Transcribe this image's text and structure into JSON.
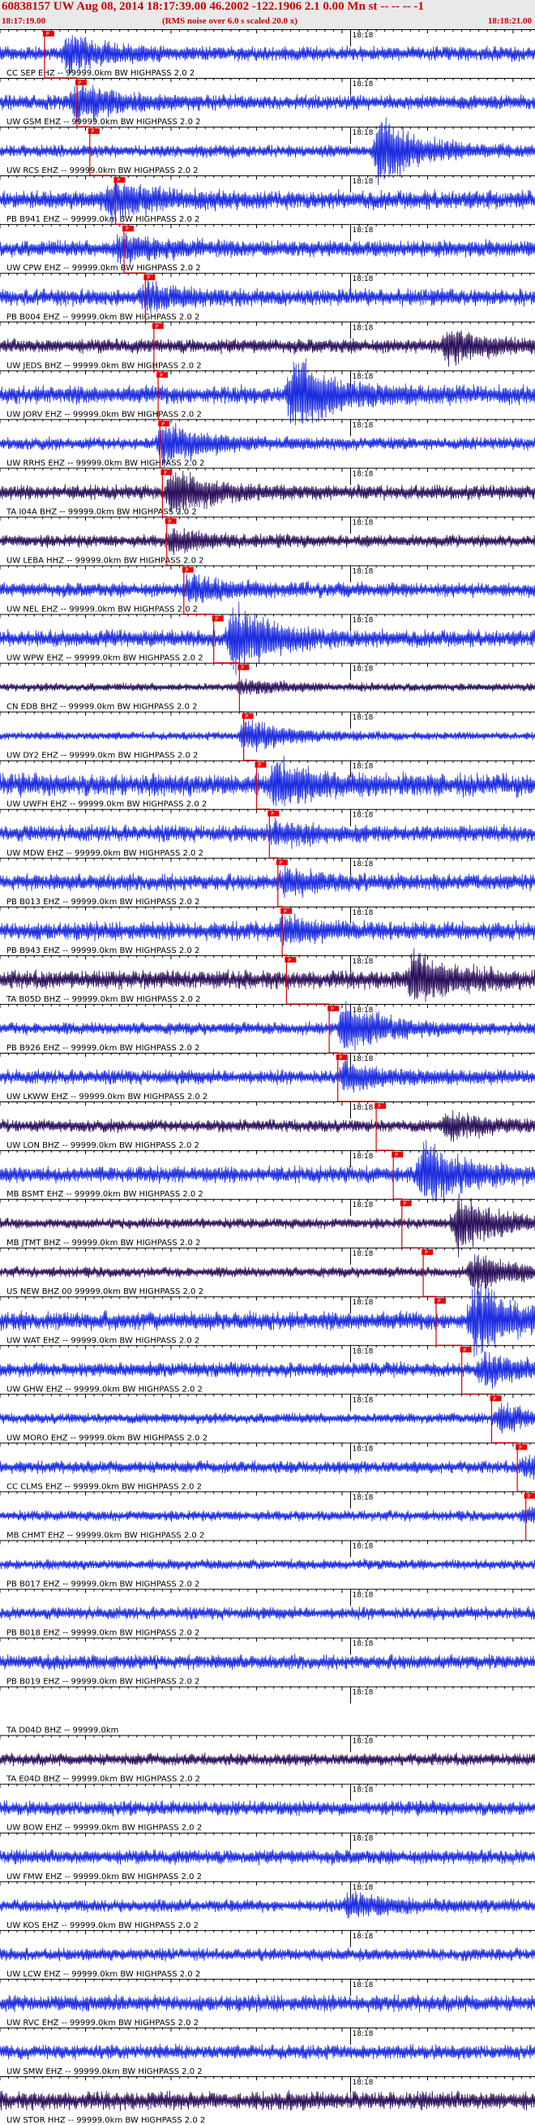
{
  "header": {
    "title": "60838157 UW Aug 08, 2014 18:17:39.00    46.2002 -122.1906  2.1 0.00 Mn st -- -- --  -1",
    "start_time": "18:17:19.00",
    "end_time": "18:18:21.00",
    "subtitle": "(RMS noise over 6.0 s scaled 20.0 x)"
  },
  "chart_data": {
    "type": "line",
    "description_free": true,
    "time_start_s": 0,
    "time_end_s": 62,
    "minute_tick_label": "18:18",
    "minute_tick_time_s": 41,
    "colors": {
      "trace": "#1a2be0",
      "trace_dark": "#2a0f5a",
      "pick": "#dd0000",
      "pick_label_bg": "#ee0000",
      "text": "#000000"
    },
    "pick_label": "P",
    "traces": [
      {
        "label": "CC SEP EHZ -- 99999.0km BW  HIGHPASS  2.0  2",
        "pick_s": 5.2,
        "amp": 0.35,
        "event_s": 8,
        "event_amp": 0.8,
        "dark": false
      },
      {
        "label": "UW GSM EHZ -- 99999.0km BW  HIGHPASS  2.0  2",
        "pick_s": 9.0,
        "amp": 0.35,
        "event_s": 9,
        "event_amp": 0.9,
        "dark": false
      },
      {
        "label": "UW RCS EHZ -- 99999.0km BW  HIGHPASS  2.0  2",
        "pick_s": 10.5,
        "amp": 0.3,
        "event_s": 44,
        "event_amp": 1.6,
        "dark": false
      },
      {
        "label": "PB B941 EHZ -- 99999.0km BW  HIGHPASS  2.0  2",
        "pick_s": 13.5,
        "amp": 0.45,
        "event_s": 13,
        "event_amp": 0.7,
        "dark": false
      },
      {
        "label": "UW CPW EHZ -- 99999.0km BW  HIGHPASS  2.0  2",
        "pick_s": 14.5,
        "amp": 0.4,
        "event_s": 14,
        "event_amp": 0.6,
        "dark": false
      },
      {
        "label": "PB B004 EHZ -- 99999.0km BW  HIGHPASS  2.0  2",
        "pick_s": 17.0,
        "amp": 0.4,
        "event_s": 17,
        "event_amp": 0.5,
        "dark": false
      },
      {
        "label": "UW JEDS BHZ -- 99999.0km BW  HIGHPASS  2.0  2",
        "pick_s": 18.0,
        "amp": 0.35,
        "event_s": 52,
        "event_amp": 0.8,
        "dark": true
      },
      {
        "label": "UW JORV EHZ -- 99999.0km BW  HIGHPASS  2.0  2",
        "pick_s": 18.5,
        "amp": 0.45,
        "event_s": 34,
        "event_amp": 1.8,
        "dark": false
      },
      {
        "label": "UW RRHS EHZ -- 99999.0km BW  HIGHPASS  2.0  2",
        "pick_s": 18.7,
        "amp": 0.3,
        "event_s": 19,
        "event_amp": 1.0,
        "dark": false
      },
      {
        "label": "TA I04A BHZ -- 99999.0km BW  HIGHPASS  2.0  2",
        "pick_s": 19.0,
        "amp": 0.35,
        "event_s": 20,
        "event_amp": 1.1,
        "dark": true
      },
      {
        "label": "UW LEBA HHZ -- 99999.0km BW  HIGHPASS  2.0  2",
        "pick_s": 19.5,
        "amp": 0.3,
        "event_s": 20,
        "event_amp": 0.5,
        "dark": true
      },
      {
        "label": "UW NEL EHZ -- 99999.0km BW  HIGHPASS  2.0  2",
        "pick_s": 21.5,
        "amp": 0.35,
        "event_s": 22,
        "event_amp": 0.6,
        "dark": false
      },
      {
        "label": "UW WPW EHZ -- 99999.0km BW  HIGHPASS  2.0  2",
        "pick_s": 25.0,
        "amp": 0.4,
        "event_s": 27,
        "event_amp": 1.6,
        "dark": false
      },
      {
        "label": "CN EDB BHZ -- 99999.0km BW  HIGHPASS  2.0  2",
        "pick_s": 28.0,
        "amp": 0.2,
        "event_s": 28,
        "event_amp": 0.3,
        "dark": true
      },
      {
        "label": "UW DY2 EHZ -- 99999.0km BW  HIGHPASS  2.0  2",
        "pick_s": 28.5,
        "amp": 0.2,
        "event_s": 28.5,
        "event_amp": 0.8,
        "dark": false
      },
      {
        "label": "UW UWFH EHZ -- 99999.0km BW  HIGHPASS  2.0  2",
        "pick_s": 30.0,
        "amp": 0.55,
        "event_s": 32,
        "event_amp": 0.9,
        "dark": false
      },
      {
        "label": "UW MDW EHZ -- 99999.0km BW  HIGHPASS  2.0  2",
        "pick_s": 31.5,
        "amp": 0.4,
        "event_s": 32,
        "event_amp": 0.5,
        "dark": false
      },
      {
        "label": "PB B013 EHZ -- 99999.0km BW  HIGHPASS  2.0  2",
        "pick_s": 32.5,
        "amp": 0.4,
        "event_s": 33,
        "event_amp": 0.5,
        "dark": false
      },
      {
        "label": "PB B943 EHZ -- 99999.0km BW  HIGHPASS  2.0  2",
        "pick_s": 33.0,
        "amp": 0.45,
        "event_s": 33,
        "event_amp": 0.5,
        "dark": false
      },
      {
        "label": "TA B05D BHZ -- 99999.0km BW  HIGHPASS  2.0  2",
        "pick_s": 33.5,
        "amp": 0.45,
        "event_s": 48,
        "event_amp": 1.2,
        "dark": true
      },
      {
        "label": "PB B926 EHZ -- 99999.0km BW  HIGHPASS  2.0  2",
        "pick_s": 38.5,
        "amp": 0.3,
        "event_s": 40,
        "event_amp": 1.2,
        "dark": false
      },
      {
        "label": "UW LKWW EHZ -- 99999.0km BW  HIGHPASS  2.0  2",
        "pick_s": 39.5,
        "amp": 0.35,
        "event_s": 40,
        "event_amp": 0.6,
        "dark": false
      },
      {
        "label": "UW LON BHZ -- 99999.0km BW  HIGHPASS  2.0  2",
        "pick_s": 44.0,
        "amp": 0.3,
        "event_s": 52,
        "event_amp": 0.6,
        "dark": true
      },
      {
        "label": "MB BSMT EHZ -- 99999.0km BW  HIGHPASS  2.0  2",
        "pick_s": 46.0,
        "amp": 0.4,
        "event_s": 49,
        "event_amp": 1.6,
        "dark": false
      },
      {
        "label": "MB JTMT BHZ -- 99999.0km BW  HIGHPASS  2.0  2",
        "pick_s": 47.0,
        "amp": 0.25,
        "event_s": 53,
        "event_amp": 1.4,
        "dark": true
      },
      {
        "label": "US NEW BHZ 00 99999.0km BW  HIGHPASS  2.0  2",
        "pick_s": 49.5,
        "amp": 0.25,
        "event_s": 55,
        "event_amp": 0.9,
        "dark": true
      },
      {
        "label": "UW WAT EHZ -- 99999.0km BW  HIGHPASS  2.0  2",
        "pick_s": 51.0,
        "amp": 0.45,
        "event_s": 55,
        "event_amp": 1.8,
        "dark": false
      },
      {
        "label": "UW GHW EHZ -- 99999.0km BW  HIGHPASS  2.0  2",
        "pick_s": 54.0,
        "amp": 0.35,
        "event_s": 56,
        "event_amp": 0.7,
        "dark": false
      },
      {
        "label": "UW MORO EHZ -- 99999.0km BW  HIGHPASS  2.0  2",
        "pick_s": 57.5,
        "amp": 0.25,
        "event_s": 58,
        "event_amp": 0.6,
        "dark": false
      },
      {
        "label": "CC CLMS EHZ -- 99999.0km BW  HIGHPASS  2.0  2",
        "pick_s": 60.5,
        "amp": 0.3,
        "event_s": 61,
        "event_amp": 0.4,
        "dark": false
      },
      {
        "label": "MB CHMT EHZ -- 99999.0km BW  HIGHPASS  2.0  2",
        "pick_s": 61.5,
        "amp": 0.25,
        "event_s": 61,
        "event_amp": 0.3,
        "dark": false
      },
      {
        "label": "PB B017 EHZ -- 99999.0km BW  HIGHPASS  2.0  2",
        "pick_s": null,
        "amp": 0.25,
        "event_s": null,
        "event_amp": 0,
        "dark": false
      },
      {
        "label": "PB B018 EHZ -- 99999.0km BW  HIGHPASS  2.0  2",
        "pick_s": null,
        "amp": 0.3,
        "event_s": null,
        "event_amp": 0,
        "dark": false
      },
      {
        "label": "PB B019 EHZ -- 99999.0km BW  HIGHPASS  2.0  2",
        "pick_s": null,
        "amp": 0.35,
        "event_s": null,
        "event_amp": 0,
        "dark": false
      },
      {
        "label": "TA D04D BHZ -- 99999.0km",
        "pick_s": null,
        "amp": 0.0,
        "event_s": null,
        "event_amp": 0,
        "dark": true
      },
      {
        "label": "TA E04D BHZ -- 99999.0km BW  HIGHPASS  2.0  2",
        "pick_s": null,
        "amp": 0.3,
        "event_s": null,
        "event_amp": 0,
        "dark": true
      },
      {
        "label": "UW BOW EHZ -- 99999.0km BW  HIGHPASS  2.0  2",
        "pick_s": null,
        "amp": 0.35,
        "event_s": null,
        "event_amp": 0,
        "dark": false
      },
      {
        "label": "UW FMW EHZ -- 99999.0km BW  HIGHPASS  2.0  2",
        "pick_s": null,
        "amp": 0.35,
        "event_s": null,
        "event_amp": 0,
        "dark": false
      },
      {
        "label": "UW KOS EHZ -- 99999.0km BW  HIGHPASS  2.0  2",
        "pick_s": null,
        "amp": 0.3,
        "event_s": 40.5,
        "event_amp": 0.6,
        "dark": false
      },
      {
        "label": "UW LCW EHZ -- 99999.0km BW  HIGHPASS  2.0  2",
        "pick_s": null,
        "amp": 0.3,
        "event_s": null,
        "event_amp": 0,
        "dark": false
      },
      {
        "label": "UW RVC EHZ -- 99999.0km BW  HIGHPASS  2.0  2",
        "pick_s": null,
        "amp": 0.4,
        "event_s": null,
        "event_amp": 0,
        "dark": false
      },
      {
        "label": "UW SMW EHZ -- 99999.0km BW  HIGHPASS  2.0  2",
        "pick_s": null,
        "amp": 0.35,
        "event_s": null,
        "event_amp": 0,
        "dark": false
      },
      {
        "label": "UW STOR HHZ -- 99999.0km BW  HIGHPASS  2.0  2",
        "pick_s": null,
        "amp": 0.45,
        "event_s": null,
        "event_amp": 0,
        "dark": true
      }
    ]
  }
}
